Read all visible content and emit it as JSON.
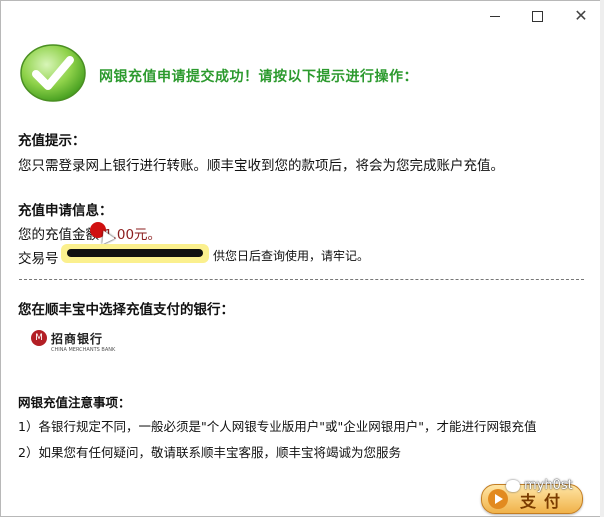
{
  "window": {
    "minimize_icon": "minimize-icon",
    "maximize_icon": "maximize-icon",
    "close_icon": "close-icon",
    "close_glyph": "✕"
  },
  "header": {
    "success_message": "网银充值申请提交成功！请按以下提示进行操作：",
    "check_icon": "check-icon"
  },
  "tips": {
    "title": "充值提示：",
    "body": "您只需登录网上银行进行转账。顺丰宝收到您的款项后，将会为您完成账户充值。"
  },
  "application": {
    "title": "充值申请信息：",
    "amount_prefix": "您的充值金额",
    "amount_value": "1.00元。",
    "txn_label": "交易号",
    "txn_suffix": "供您日后查询使用，请牢记。"
  },
  "bank_section": {
    "title": "您在顺丰宝中选择充值支付的银行：",
    "bank_name": "招商银行",
    "bank_subtext": "CHINA MERCHANTS BANK",
    "bank_emblem": "M"
  },
  "notes": {
    "title": "网银充值注意事项：",
    "items": [
      "1）各银行规定不同，一般必须是\"个人网银专业版用户\"或\"企业网银用户\"，才能进行网银充值",
      "2）如果您有任何疑问，敬请联系顺丰宝客服，顺丰宝将竭诚为您服务"
    ]
  },
  "pay_button": {
    "label": "支付"
  },
  "watermark": {
    "text": "myh0st"
  },
  "colors": {
    "success_green": "#2c9a2e",
    "amount_red": "#8b1d1d",
    "button_orange": "#f0b24a"
  }
}
